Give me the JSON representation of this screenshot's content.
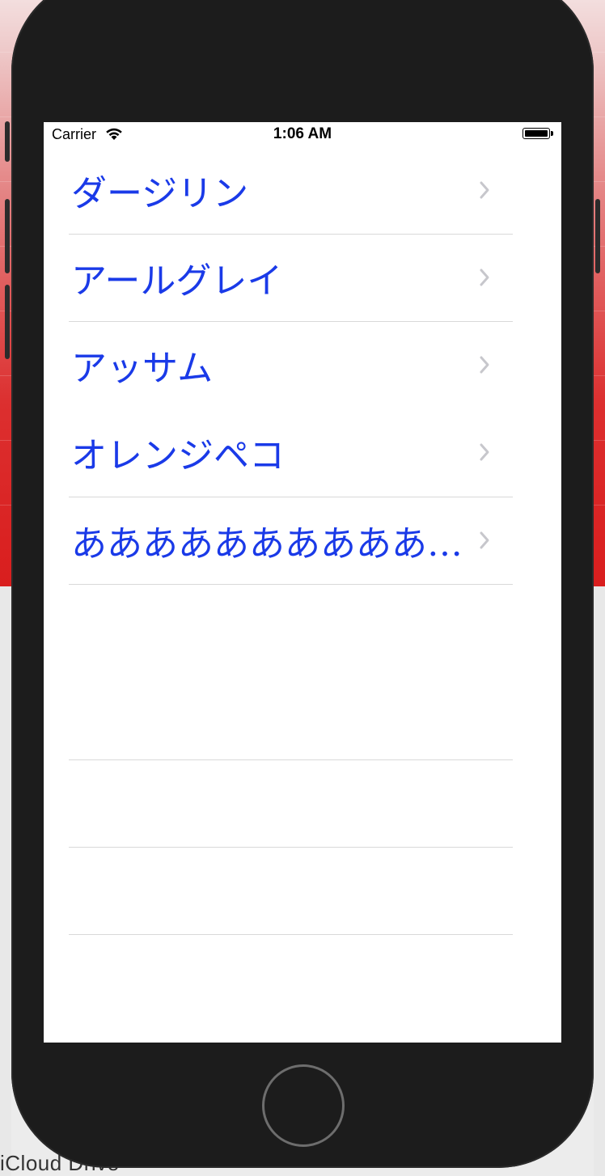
{
  "background": {
    "bottom_label": "iCloud Drive"
  },
  "status_bar": {
    "carrier": "Carrier",
    "time": "1:06 AM"
  },
  "table": {
    "rows": [
      {
        "label": "ダージリン"
      },
      {
        "label": "アールグレイ"
      },
      {
        "label": "アッサム"
      },
      {
        "label": "オレンジペコ"
      },
      {
        "label": "ああああああああああ…"
      }
    ]
  },
  "colors": {
    "label": "#1a3ae8",
    "chevron": "#c7c7cc",
    "separator": "#d9d9d9"
  }
}
